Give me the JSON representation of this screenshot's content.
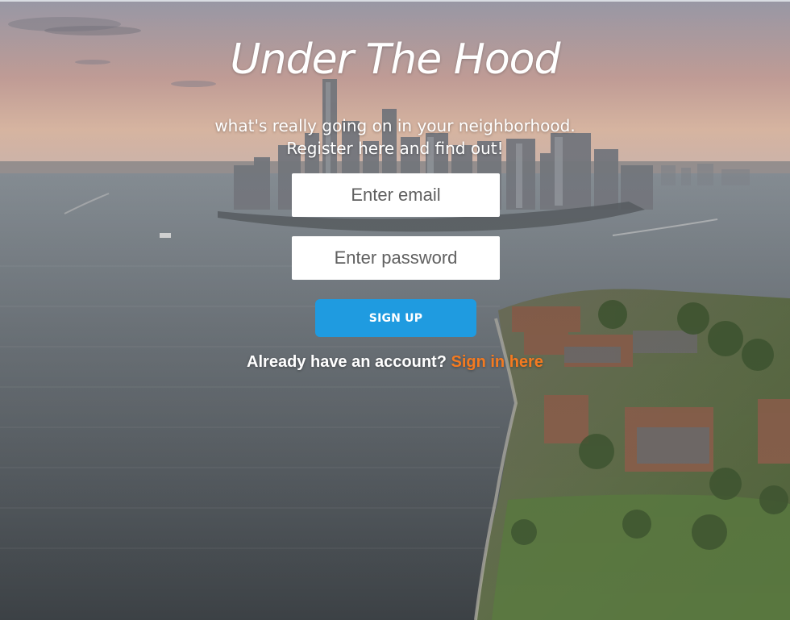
{
  "app": {
    "title": "Under The Hood"
  },
  "hero": {
    "tagline_line1": "what's really going on in your neighborhood.",
    "tagline_line2": "Register here and find out!"
  },
  "form": {
    "email_placeholder": "Enter email",
    "email_value": "",
    "password_placeholder": "Enter password",
    "password_value": "",
    "signup_label": "SIGN UP"
  },
  "signin": {
    "prompt": "Already have an account?",
    "link_label": "Sign in here"
  },
  "colors": {
    "signup_button": "#1f9be0",
    "signin_link": "#f47a20",
    "text": "#ffffff",
    "field_background": "#ffffff"
  },
  "background": {
    "description_icon": "aerial-city-harbor-photo"
  }
}
